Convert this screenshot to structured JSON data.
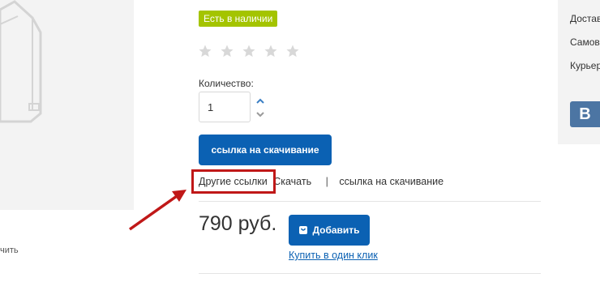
{
  "product": {
    "availability_badge": "Есть в наличии",
    "rating": {
      "value": 0,
      "max": 5
    },
    "quantity_label": "Количество:",
    "quantity_value": "1",
    "download_button_label": "ссылка на скачивание",
    "links": {
      "other_links": "Другие ссылки",
      "download": "Скачать",
      "separator": "|",
      "download_link": "ссылка на скачивание"
    },
    "price": "790 руб.",
    "add_button_label": "Добавить",
    "one_click_label": "Купить в один клик"
  },
  "image_area": {
    "zoom_hint": "чить"
  },
  "right_panel": {
    "items": [
      "Достав",
      "Самов",
      "Курьер"
    ],
    "social_icon_letter": "В"
  },
  "colors": {
    "badge": "#a4c400",
    "primary_button": "#0b61b3",
    "highlight": "#c01818",
    "vk": "#4c75a3"
  }
}
